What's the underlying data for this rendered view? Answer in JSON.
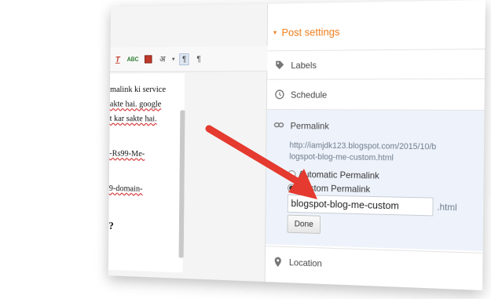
{
  "toolbar": {
    "clear_format_label": "T",
    "spellcheck_label": "ABC",
    "transliterate_label": "अ",
    "dropdown_caret": "▾",
    "ltr_label": "¶",
    "rtl_label": "¶"
  },
  "document": {
    "lines": [
      {
        "text": "malink ki service",
        "wavy": false
      },
      {
        "text": "akte hai. google",
        "wavy": true
      },
      {
        "text": "t kar sakte hai.",
        "wavy": true
      },
      {
        "text": "-Rs99-Me-",
        "wavy": true
      },
      {
        "text": "9-domain-",
        "wavy": true
      },
      {
        "text": "?",
        "wavy": false
      }
    ]
  },
  "post_settings": {
    "title": "Post settings",
    "caret": "▾",
    "labels_label": "Labels",
    "schedule_label": "Schedule",
    "permalink": {
      "label": "Permalink",
      "url_line1": "http://iamjdk123.blogspot.com/2015/10/b",
      "url_line2": "logspot-blog-me-custom.html",
      "automatic_label": "Automatic Permalink",
      "custom_label": "Custom Permalink",
      "slug_value": "blogspot-blog-me-custom",
      "suffix": ".html",
      "done_label": "Done"
    },
    "location_label": "Location"
  },
  "colors": {
    "accent": "#f07c1a",
    "arrow": "#e53a2f",
    "permalink_bg": "#eef3fb"
  },
  "icons": [
    "clear-formatting-icon",
    "spellcheck-icon",
    "image-icon",
    "transliterate-icon",
    "ltr-icon",
    "rtl-icon",
    "label-tag-icon",
    "clock-icon",
    "link-icon",
    "map-pin-icon",
    "red-arrow"
  ]
}
